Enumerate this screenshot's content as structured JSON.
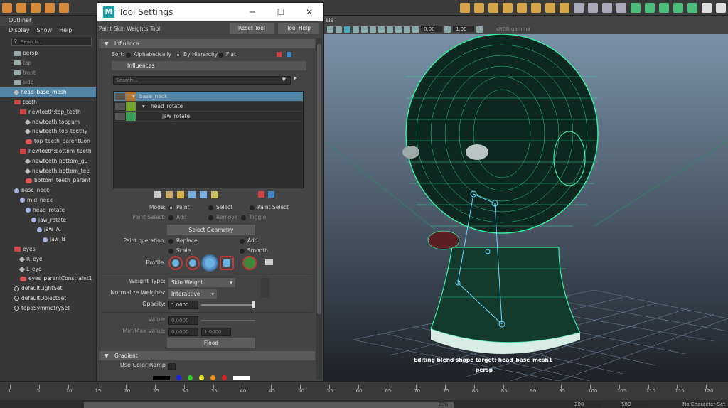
{
  "outliner": {
    "tab": "Outliner",
    "menu": [
      "Display",
      "Show",
      "Help"
    ],
    "search_placeholder": "Search...",
    "items": [
      {
        "label": "persp",
        "icon": "camera-icon",
        "indent": 1,
        "dim": false
      },
      {
        "label": "top",
        "icon": "camera-icon",
        "indent": 1,
        "dim": true
      },
      {
        "label": "front",
        "icon": "camera-icon",
        "indent": 1,
        "dim": true
      },
      {
        "label": "side",
        "icon": "camera-icon",
        "indent": 1,
        "dim": true
      },
      {
        "label": "head_base_mesh",
        "icon": "mesh-icon",
        "indent": 1,
        "selected": true
      },
      {
        "label": "teeth",
        "icon": "group-icon",
        "indent": 1
      },
      {
        "label": "newteeth:top_teeth",
        "icon": "group-icon",
        "indent": 2
      },
      {
        "label": "newteeth:topgum",
        "icon": "mesh-icon",
        "indent": 3
      },
      {
        "label": "newteeth:top_teethy",
        "icon": "mesh-icon",
        "indent": 3
      },
      {
        "label": "top_teeth_parentCon",
        "icon": "constraint-icon",
        "indent": 3
      },
      {
        "label": "newteeth:bottom_teeth",
        "icon": "group-icon",
        "indent": 2
      },
      {
        "label": "newteeth:bottom_gu",
        "icon": "mesh-icon",
        "indent": 3
      },
      {
        "label": "newteeth:bottom_tee",
        "icon": "mesh-icon",
        "indent": 3
      },
      {
        "label": "bottom_teeth_parent",
        "icon": "constraint-icon",
        "indent": 3
      },
      {
        "label": "base_neck",
        "icon": "joint-icon",
        "indent": 1
      },
      {
        "label": "mid_neck",
        "icon": "joint-icon",
        "indent": 2
      },
      {
        "label": "head_rotate",
        "icon": "joint-icon",
        "indent": 3
      },
      {
        "label": "jaw_rotate",
        "icon": "joint-icon",
        "indent": 4
      },
      {
        "label": "jaw_A",
        "icon": "joint-icon",
        "indent": 5
      },
      {
        "label": "jaw_B",
        "icon": "joint-icon",
        "indent": 6
      },
      {
        "label": "eyes",
        "icon": "group-icon",
        "indent": 1
      },
      {
        "label": "R_eye",
        "icon": "mesh-icon",
        "indent": 2
      },
      {
        "label": "L_eye",
        "icon": "mesh-icon",
        "indent": 2
      },
      {
        "label": "eyes_parentConstraint1",
        "icon": "constraint-icon",
        "indent": 2
      },
      {
        "label": "defaultLightSet",
        "icon": "set-icon",
        "indent": 1
      },
      {
        "label": "defaultObjectSet",
        "icon": "set-icon",
        "indent": 1
      },
      {
        "label": "topoSymmetrySet",
        "icon": "set-icon",
        "indent": 1
      }
    ]
  },
  "tool_settings": {
    "window_title": "Tool Settings",
    "logo": "M",
    "tool_name": "Paint Skin Weights Tool",
    "reset_label": "Reset Tool",
    "help_label": "Tool Help",
    "influence": {
      "header": "Influence",
      "sort_label": "Sort:",
      "sort_options": [
        "Alphabetically",
        "By Hierarchy",
        "Flat"
      ],
      "influences_header": "Influences",
      "search_placeholder": "Search...",
      "list": [
        {
          "label": "base_neck",
          "color": "#b9742f",
          "indent": 0,
          "selected": true
        },
        {
          "label": "head_rotate",
          "color": "#6fa52e",
          "indent": 1,
          "selected": false
        },
        {
          "label": "jaw_rotate",
          "color": "#3a9f55",
          "indent": 2,
          "selected": false
        }
      ]
    },
    "mode": {
      "label": "Mode:",
      "options": [
        "Paint",
        "Select",
        "Paint Select"
      ],
      "paint_select_label": "Paint Select:",
      "paint_select_options": [
        "Add",
        "Remove",
        "Toggle"
      ],
      "select_geometry": "Select Geometry"
    },
    "paint_operation": {
      "label": "Paint operation:",
      "options": [
        "Replace",
        "Add",
        "Scale",
        "Smooth"
      ]
    },
    "profile_label": "Profile:",
    "weight_type": {
      "label": "Weight Type:",
      "value": "Skin Weight"
    },
    "normalize_weights": {
      "label": "Normalize Weights:",
      "value": "Interactive"
    },
    "opacity": {
      "label": "Opacity:",
      "value": "1.0000"
    },
    "value": {
      "label": "Value:",
      "value": "0.0000"
    },
    "min_max": {
      "label": "Min/Max value:",
      "min": "0.0000",
      "max": "1.0000"
    },
    "flood": "Flood",
    "gradient": {
      "header": "Gradient",
      "use_color_ramp": "Use Color Ramp"
    }
  },
  "viewport": {
    "panel_label": "els",
    "field_a": "0.00",
    "field_b": "1.00",
    "colorspace": "sRGB gamma",
    "message": "Editing blend shape target: head_base_mesh1",
    "camera": "persp"
  },
  "timeline": {
    "ticks": [
      "1",
      "5",
      "10",
      "15",
      "20",
      "25",
      "30",
      "35",
      "40",
      "45",
      "50",
      "55",
      "60",
      "65",
      "70",
      "75",
      "80",
      "85",
      "90",
      "95",
      "100",
      "105",
      "110",
      "115",
      "120"
    ],
    "range_end": "200",
    "status_a": "200",
    "status_b": "500",
    "character_set": "No Character Set"
  }
}
